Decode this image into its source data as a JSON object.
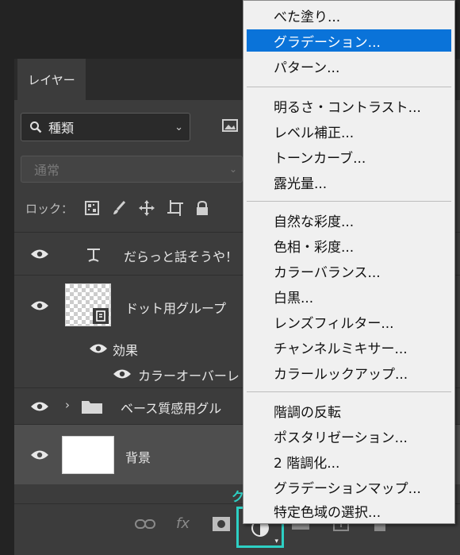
{
  "panel": {
    "tab_label": "レイヤー",
    "filter_label": "種類",
    "blend_mode": "通常",
    "lock_label": "ロック："
  },
  "layers": [
    {
      "name": "だらっと話そうや！",
      "type": "text"
    },
    {
      "name": "ドット用グループ",
      "type": "smart-object"
    },
    {
      "name": "効果",
      "type": "effects"
    },
    {
      "name": "カラーオーバーレ",
      "type": "effect-item"
    },
    {
      "name": "ベース質感用グル",
      "type": "group"
    },
    {
      "name": "背景",
      "type": "background"
    }
  ],
  "menu": {
    "groups": [
      [
        "べた塗り...",
        "グラデーション...",
        "パターン..."
      ],
      [
        "明るさ・コントラスト...",
        "レベル補正...",
        "トーンカーブ...",
        "露光量..."
      ],
      [
        "自然な彩度...",
        "色相・彩度...",
        "カラーバランス...",
        "白黒...",
        "レンズフィルター...",
        "チャンネルミキサー...",
        "カラールックアップ..."
      ],
      [
        "階調の反転",
        "ポスタリゼーション...",
        "2 階調化...",
        "グラデーションマップ...",
        "特定色域の選択..."
      ]
    ],
    "selected": "グラデーション..."
  },
  "annotation": {
    "click_label": "クリック"
  },
  "colors": {
    "highlight": "#2dd0c4",
    "menu_selected": "#0a73d9"
  }
}
